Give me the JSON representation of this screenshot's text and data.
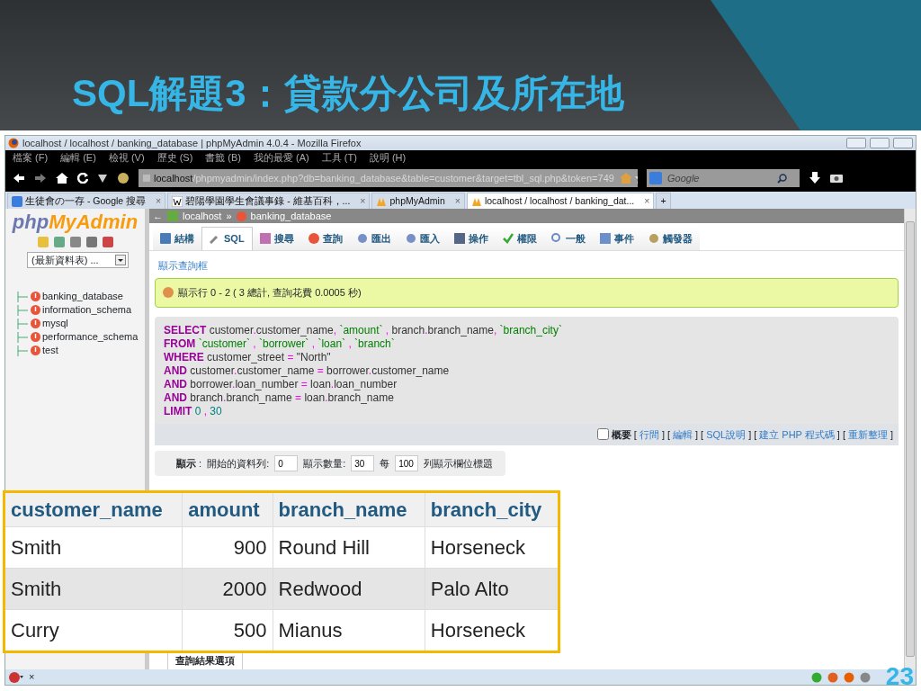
{
  "slide": {
    "title": "SQL解題3：貸款分公司及所在地",
    "page_number": "23"
  },
  "window": {
    "title": "localhost / localhost / banking_database | phpMyAdmin 4.0.4 - Mozilla Firefox"
  },
  "menu_bar": [
    "檔案 (F)",
    "編輯 (E)",
    "檢視 (V)",
    "歷史 (S)",
    "書籤 (B)",
    "我的最愛 (A)",
    "工具 (T)",
    "說明 (H)"
  ],
  "address_bar": {
    "host": "localhost",
    "path": "/phpmyadmin/index.php?db=banking_database&table=customer&target=tbl_sql.php&token=749"
  },
  "search": {
    "placeholder": "Google"
  },
  "tabs": [
    {
      "kind": "google",
      "label": "生徒會の一存 - Google 搜尋",
      "close": "×",
      "selected": false
    },
    {
      "kind": "wiki",
      "label": "碧陽學園學生會議事錄 - 維基百科，...",
      "close": "×",
      "selected": false
    },
    {
      "kind": "pma",
      "label": "phpMyAdmin",
      "close": "×",
      "selected": false
    },
    {
      "kind": "pma",
      "label": "localhost / localhost / banking_dat...",
      "close": "×",
      "selected": true
    }
  ],
  "new_tab": "+",
  "sidebar": {
    "logo_left": "php",
    "logo_right": "MyAdmin",
    "recent": "(最新資料表) ...",
    "databases": [
      "banking_database",
      "information_schema",
      "mysql",
      "performance_schema",
      "test"
    ]
  },
  "breadcrumb": {
    "back": "←",
    "server": "localhost",
    "separator": "»",
    "database": "banking_database"
  },
  "db_tabs": [
    {
      "label": "結構",
      "selected": false
    },
    {
      "label": "SQL",
      "selected": true
    },
    {
      "label": "搜尋",
      "selected": false
    },
    {
      "label": "查詢",
      "selected": false
    },
    {
      "label": "匯出",
      "selected": false
    },
    {
      "label": "匯入",
      "selected": false
    },
    {
      "label": "操作",
      "selected": false
    },
    {
      "label": "權限",
      "selected": false
    },
    {
      "label": "一般",
      "selected": false
    },
    {
      "label": "事件",
      "selected": false
    },
    {
      "label": "觸發器",
      "selected": false
    }
  ],
  "show_query_link": "顯示查詢框",
  "message": "顯示行 0 - 2 ( 3 總計, 查詢花費 0.0005 秒)",
  "sql_lines": [
    [
      {
        "kind": "keyword",
        "text": "SELECT"
      },
      {
        "kind": "plain",
        "text": " customer"
      },
      {
        "kind": "op",
        "text": "."
      },
      {
        "kind": "plain",
        "text": "customer_name"
      },
      {
        "kind": "op",
        "text": ","
      },
      {
        "kind": "string",
        "text": " `amount`"
      },
      {
        "kind": "op",
        "text": " ,"
      },
      {
        "kind": "plain",
        "text": " branch"
      },
      {
        "kind": "op",
        "text": "."
      },
      {
        "kind": "plain",
        "text": "branch_name"
      },
      {
        "kind": "op",
        "text": ","
      },
      {
        "kind": "string",
        "text": " `branch_city`"
      }
    ],
    [
      {
        "kind": "keyword",
        "text": "FROM"
      },
      {
        "kind": "string",
        "text": " `customer`"
      },
      {
        "kind": "op",
        "text": " ,"
      },
      {
        "kind": "string",
        "text": " `borrower`"
      },
      {
        "kind": "op",
        "text": " ,"
      },
      {
        "kind": "string",
        "text": " `loan`"
      },
      {
        "kind": "op",
        "text": " ,"
      },
      {
        "kind": "string",
        "text": " `branch`"
      }
    ],
    [
      {
        "kind": "keyword",
        "text": "WHERE"
      },
      {
        "kind": "plain",
        "text": " customer_street"
      },
      {
        "kind": "op",
        "text": " ="
      },
      {
        "kind": "plain",
        "text": " \"North\""
      }
    ],
    [
      {
        "kind": "keyword",
        "text": "AND"
      },
      {
        "kind": "plain",
        "text": " customer"
      },
      {
        "kind": "op",
        "text": "."
      },
      {
        "kind": "plain",
        "text": "customer_name"
      },
      {
        "kind": "op",
        "text": " ="
      },
      {
        "kind": "plain",
        "text": " borrower"
      },
      {
        "kind": "op",
        "text": "."
      },
      {
        "kind": "plain",
        "text": "customer_name"
      }
    ],
    [
      {
        "kind": "keyword",
        "text": "AND"
      },
      {
        "kind": "plain",
        "text": " borrower"
      },
      {
        "kind": "op",
        "text": "."
      },
      {
        "kind": "plain",
        "text": "loan_number"
      },
      {
        "kind": "op",
        "text": " ="
      },
      {
        "kind": "plain",
        "text": " loan"
      },
      {
        "kind": "op",
        "text": "."
      },
      {
        "kind": "plain",
        "text": "loan_number"
      }
    ],
    [
      {
        "kind": "keyword",
        "text": "AND"
      },
      {
        "kind": "plain",
        "text": " branch"
      },
      {
        "kind": "op",
        "text": "."
      },
      {
        "kind": "plain",
        "text": "branch_name"
      },
      {
        "kind": "op",
        "text": " ="
      },
      {
        "kind": "plain",
        "text": " loan"
      },
      {
        "kind": "op",
        "text": "."
      },
      {
        "kind": "plain",
        "text": "branch_name"
      }
    ],
    [
      {
        "kind": "keyword",
        "text": "LIMIT"
      },
      {
        "kind": "number",
        "text": " 0"
      },
      {
        "kind": "op",
        "text": " ,"
      },
      {
        "kind": "number",
        "text": " 30"
      }
    ]
  ],
  "sql_options": {
    "profiling_label": "概要",
    "profiling_checked": false,
    "links": [
      {
        "left": "[",
        "label": "行間",
        "right": "]"
      },
      {
        "left": "[",
        "label": "編輯",
        "right": "]"
      },
      {
        "left": "[",
        "label": "SQL說明",
        "right": "]"
      },
      {
        "left": "[",
        "label": "建立 PHP 程式碼",
        "right": "]"
      },
      {
        "left": "[",
        "label": "重新整理",
        "right": "]"
      }
    ]
  },
  "display_options": {
    "label": "**顯示** :",
    "start_label": "開始的資料列:",
    "start": "0",
    "count_label": "顯示數量:",
    "count": "30",
    "per_label": "每",
    "per": "100",
    "header_label": "列顯示欄位標題"
  },
  "result_table": {
    "columns": [
      "customer_name",
      "amount",
      "branch_name",
      "branch_city"
    ],
    "rows": [
      [
        "Smith",
        "900",
        "Round Hill",
        "Horseneck"
      ],
      [
        "Smith",
        "2000",
        "Redwood",
        "Palo Alto"
      ],
      [
        "Curry",
        "500",
        "Mianus",
        "Horseneck"
      ]
    ]
  },
  "results_options_tab": "查詢結果選項",
  "status_bar": {
    "close": "×"
  }
}
